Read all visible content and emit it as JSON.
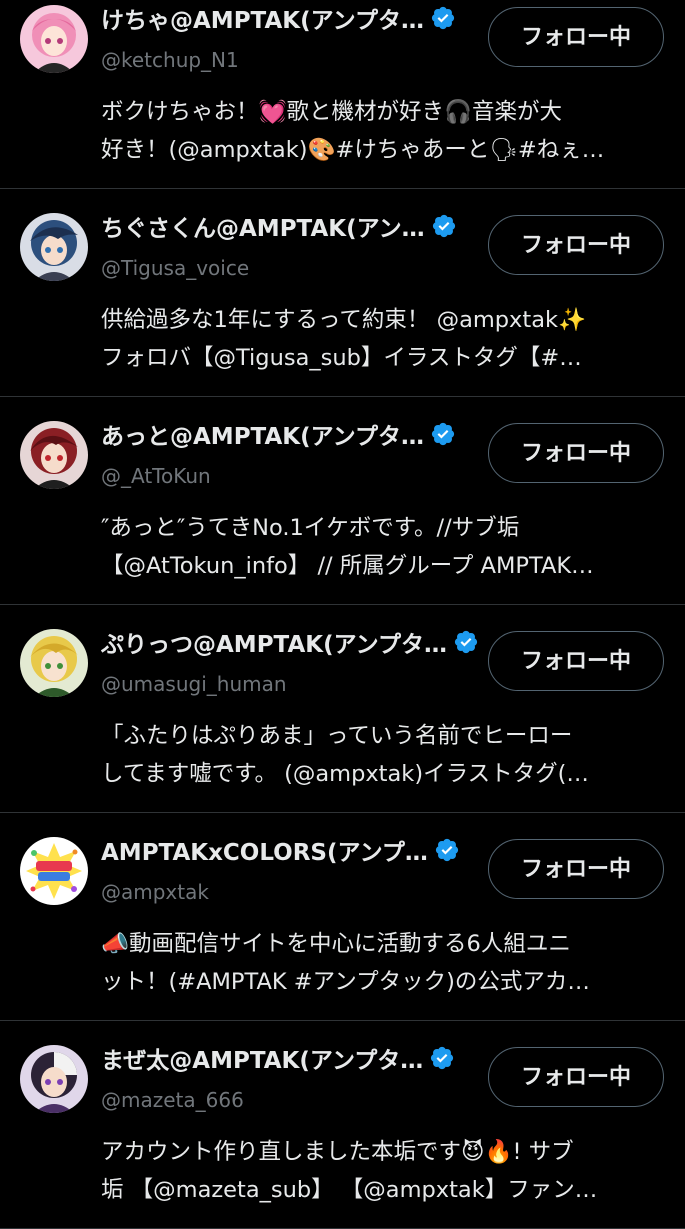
{
  "follow_label": "フォロー中",
  "colors": {
    "background": "#000000",
    "primary_text": "#e7e9ea",
    "secondary_text": "#71767b",
    "divider": "#2f3336",
    "verified": "#1d9bf0"
  },
  "users": [
    {
      "display_name": "けちゃ@AMPTAK(アンプタ…",
      "handle": "@ketchup_N1",
      "bio_lines": [
        "ボクけちゃお！💓歌と機材が好き🎧音楽が大",
        "好き！(@ampxtak)🎨#けちゃあーと🗣#ねぇ…"
      ],
      "avatar_icon": "pink-hair-avatar"
    },
    {
      "display_name": "ちぐさくん@AMPTAK(アン…",
      "handle": "@Tigusa_voice",
      "bio_lines": [
        "供給過多な1年にするって約束！ @ampxtak✨",
        "フォロバ【@Tigusa_sub】イラストタグ【#…"
      ],
      "avatar_icon": "blue-hair-avatar"
    },
    {
      "display_name": "あっと@AMPTAK(アンプタ…",
      "handle": "@_AtToKun",
      "bio_lines": [
        "″あっと″うてきNo.1イケボです。//サブ垢",
        "【@AtTokun_info】 // 所属グループ AMPTAK…"
      ],
      "avatar_icon": "red-hair-avatar"
    },
    {
      "display_name": "ぷりっつ@AMPTAK(アンプタ…",
      "handle": "@umasugi_human",
      "bio_lines": [
        "「ふたりはぷりあま」っていう名前でヒーロー",
        "してます嘘です。 (@ampxtak)イラストタグ(…"
      ],
      "avatar_icon": "blonde-hair-avatar"
    },
    {
      "display_name": "AMPTAKxCOLORS(アンプ…",
      "handle": "@ampxtak",
      "bio_lines": [
        "📣動画配信サイトを中心に活動する6人組ユニ",
        "ット！(#AMPTAK #アンプタック)の公式アカ…"
      ],
      "avatar_icon": "amptak-colors-logo"
    },
    {
      "display_name": "まぜ太@AMPTAK(アンプタ…",
      "handle": "@mazeta_666",
      "bio_lines": [
        "アカウント作り直しました本垢です😈🔥! サブ",
        "垢 【@mazeta_sub】 【@ampxtak】ファン…"
      ],
      "avatar_icon": "purple-hair-avatar"
    }
  ]
}
